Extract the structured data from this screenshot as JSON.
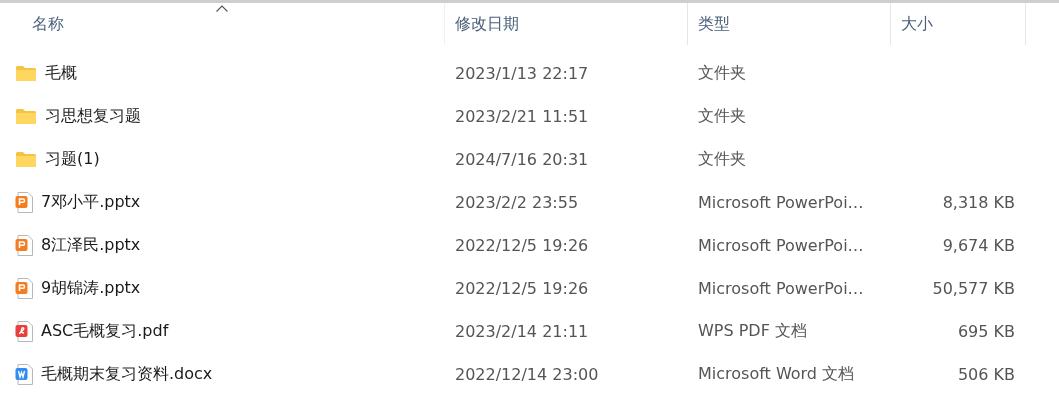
{
  "columns": [
    {
      "label": "名称",
      "sorted": true
    },
    {
      "label": "修改日期",
      "sorted": false
    },
    {
      "label": "类型",
      "sorted": false
    },
    {
      "label": "大小",
      "sorted": false
    }
  ],
  "rows": [
    {
      "kind": "folder",
      "name": "毛概",
      "date": "2023/1/13 22:17",
      "type": "文件夹"
    },
    {
      "kind": "folder",
      "name": "习思想复习题",
      "date": "2023/2/21 11:51",
      "type": "文件夹"
    },
    {
      "kind": "folder",
      "name": "习题(1)",
      "date": "2024/7/16 20:31",
      "type": "文件夹"
    },
    {
      "kind": "pptx",
      "name": "7邓小平.pptx",
      "date": "2023/2/2 23:55",
      "type": "Microsoft PowerPoi…",
      "size": "8,318 KB"
    },
    {
      "kind": "pptx",
      "name": "8江泽民.pptx",
      "date": "2022/12/5 19:26",
      "type": "Microsoft PowerPoi…",
      "size": "9,674 KB"
    },
    {
      "kind": "pptx",
      "name": "9胡锦涛.pptx",
      "date": "2022/12/5 19:26",
      "type": "Microsoft PowerPoi…",
      "size": "50,577 KB"
    },
    {
      "kind": "pdf",
      "name": "ASC毛概复习.pdf",
      "date": "2023/2/14 21:11",
      "type": "WPS PDF 文档",
      "size": "695 KB"
    },
    {
      "kind": "docx",
      "name": "毛概期末复习资料.docx",
      "date": "2022/12/14 23:00",
      "type": "Microsoft Word 文档",
      "size": "506 KB"
    }
  ]
}
